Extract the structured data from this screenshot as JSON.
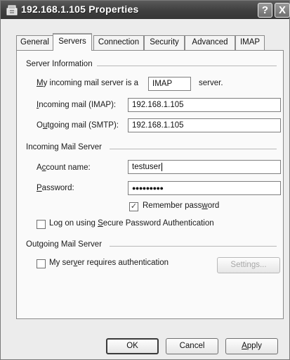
{
  "window": {
    "title": "192.168.1.105 Properties",
    "help_label": "?",
    "close_label": "X"
  },
  "tabs": [
    {
      "label": "General",
      "mnemonic": "",
      "rest": "General",
      "active": false
    },
    {
      "label": "Servers",
      "active": true
    },
    {
      "label": "Connection",
      "active": false
    },
    {
      "label": "Security",
      "active": false
    },
    {
      "label": "Advanced",
      "active": false
    },
    {
      "label": "IMAP",
      "active": false
    }
  ],
  "server_info": {
    "group_label": "Server Information",
    "incoming_type_pre_mnemonic": "M",
    "incoming_type_pre_rest": "y incoming mail server is a",
    "incoming_type_value": "IMAP",
    "incoming_type_post": "server.",
    "incoming_label_mnemonic": "I",
    "incoming_label_rest": "ncoming mail (IMAP):",
    "incoming_value": "192.168.1.105",
    "outgoing_label_pre": "O",
    "outgoing_label_mnemonic": "u",
    "outgoing_label_rest": "tgoing mail (SMTP):",
    "outgoing_value": "192.168.1.105"
  },
  "incoming_server": {
    "group_label": "Incoming Mail Server",
    "account_pre": "A",
    "account_mnemonic": "c",
    "account_rest": "count name:",
    "account_value": "testuser",
    "password_mnemonic": "P",
    "password_rest": "assword:",
    "password_value": "●●●●●●●●●",
    "remember_pre": "Remember pass",
    "remember_mnemonic": "w",
    "remember_rest": "ord",
    "remember_checked": "✓",
    "spa_pre": "Log on using ",
    "spa_mnemonic": "S",
    "spa_rest": "ecure Password Authentication"
  },
  "outgoing_server": {
    "group_label": "Outgoing Mail Server",
    "auth_pre": "My ser",
    "auth_mnemonic": "v",
    "auth_rest": "er requires authentication",
    "settings_label": "Settings..."
  },
  "buttons": {
    "ok": "OK",
    "cancel": "Cancel",
    "apply_mnemonic": "A",
    "apply_rest": "pply"
  }
}
